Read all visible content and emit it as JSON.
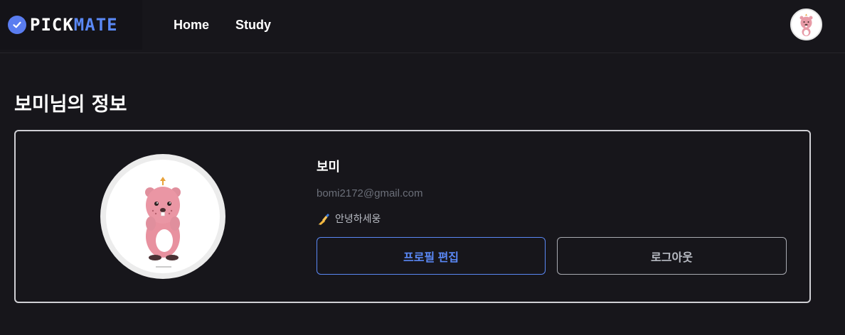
{
  "header": {
    "logo": {
      "part1": "PICK",
      "part2": "MATE"
    },
    "nav": [
      {
        "label": "Home"
      },
      {
        "label": "Study"
      }
    ]
  },
  "page": {
    "title": "보미님의 정보"
  },
  "profile": {
    "name": "보미",
    "email": "bomi2172@gmail.com",
    "bio": "안녕하세웅",
    "bio_icon": "writing-hand-icon",
    "edit_button": "프로필 편집",
    "logout_button": "로그아웃"
  },
  "colors": {
    "background": "#17161b",
    "accent": "#5a88f5",
    "card_border": "#cfcfd4"
  }
}
